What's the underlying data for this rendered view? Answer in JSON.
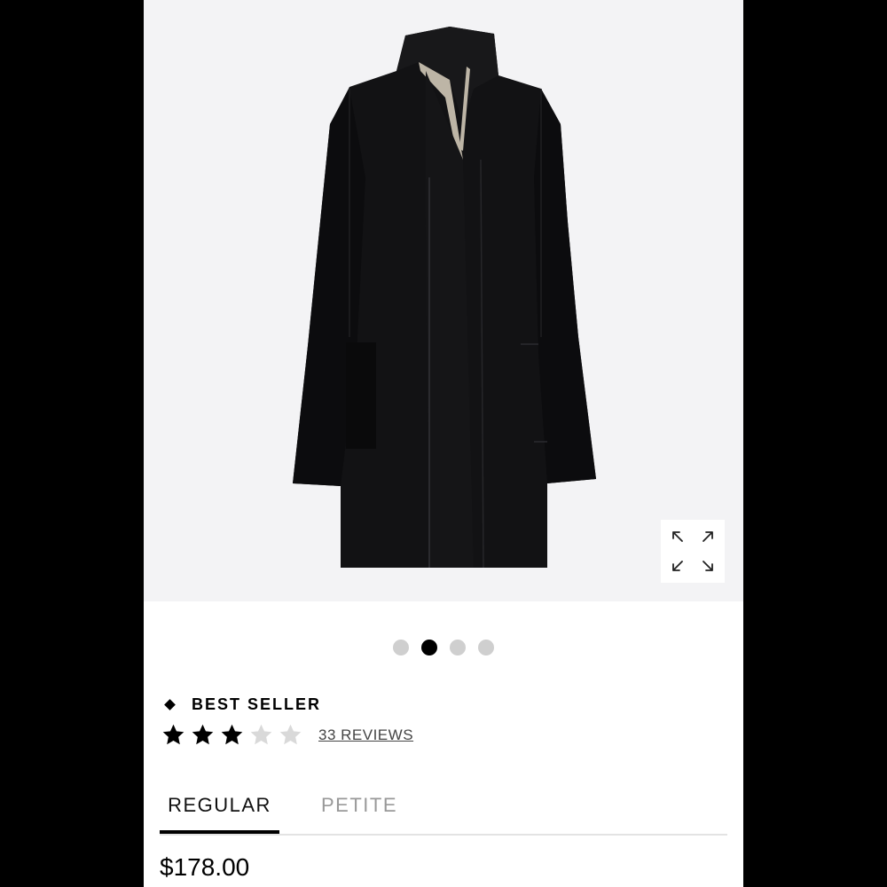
{
  "gallery": {
    "image_description_icon": "black-wool-coat-image",
    "expand_icon": "expand-arrows-icon",
    "dots": [
      {
        "active": false
      },
      {
        "active": true
      },
      {
        "active": false
      },
      {
        "active": false
      }
    ]
  },
  "product": {
    "badge": "BEST SELLER",
    "badge_icon": "diamond-icon",
    "rating": 3,
    "rating_max": 5,
    "reviews_label": "33 REVIEWS",
    "price": "$178.00"
  },
  "tabs": [
    {
      "label": "REGULAR",
      "selected": true
    },
    {
      "label": "PETITE",
      "selected": false
    }
  ],
  "colors": {
    "star_filled": "#000000",
    "star_empty": "#d9d9d9",
    "gallery_bg": "#f3f3f5",
    "frame": "#000000"
  }
}
